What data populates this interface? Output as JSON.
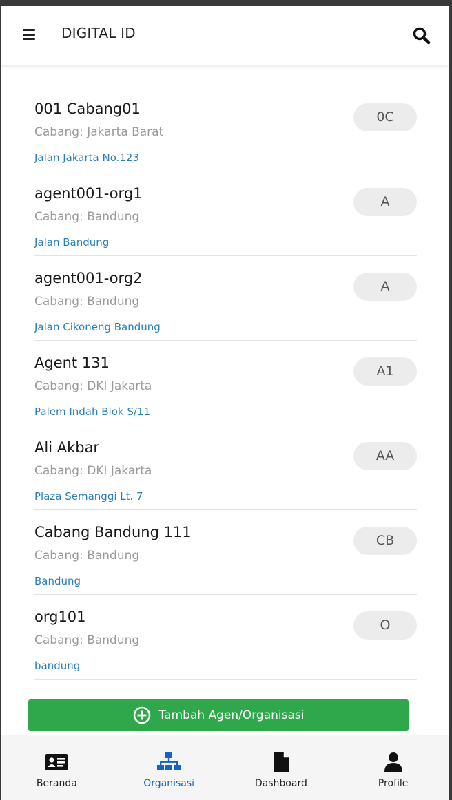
{
  "app": {
    "title": "DIGITAL ID",
    "menu_icon": "hamburger-menu-icon",
    "search_icon": "search-icon"
  },
  "colors": {
    "accent_green": "#2ea84a",
    "link_blue": "#2b7fb8",
    "nav_active": "#1565c0"
  },
  "list": {
    "items": [
      {
        "name": "001 Cabang01",
        "branch": "Cabang: Jakarta Barat",
        "address": "Jalan Jakarta No.123",
        "badge": "0C"
      },
      {
        "name": "agent001-org1",
        "branch": "Cabang: Bandung",
        "address": "Jalan Bandung",
        "badge": "A"
      },
      {
        "name": "agent001-org2",
        "branch": "Cabang: Bandung",
        "address": "Jalan Cikoneng Bandung",
        "badge": "A"
      },
      {
        "name": "Agent 131",
        "branch": "Cabang: DKI Jakarta",
        "address": "Palem Indah Blok S/11",
        "badge": "A1"
      },
      {
        "name": "Ali Akbar",
        "branch": "Cabang: DKI Jakarta",
        "address": "Plaza Semanggi Lt. 7",
        "badge": "AA"
      },
      {
        "name": "Cabang Bandung 111",
        "branch": "Cabang: Bandung",
        "address": "Bandung",
        "badge": "CB"
      },
      {
        "name": "org101",
        "branch": "Cabang: Bandung",
        "address": "bandung",
        "badge": "O"
      }
    ]
  },
  "add_button": {
    "label": "Tambah Agen/Organisasi",
    "icon": "plus-circle-icon"
  },
  "bottom_nav": {
    "items": [
      {
        "label": "Beranda",
        "icon": "id-card-icon",
        "active": false
      },
      {
        "label": "Organisasi",
        "icon": "org-chart-icon",
        "active": true
      },
      {
        "label": "Dashboard",
        "icon": "document-icon",
        "active": false
      },
      {
        "label": "Profile",
        "icon": "user-icon",
        "active": false
      }
    ]
  }
}
